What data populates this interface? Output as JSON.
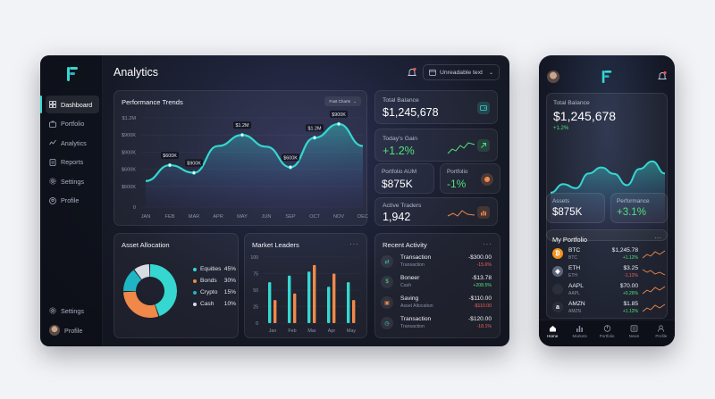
{
  "desktop": {
    "title": "Analytics",
    "date_selector": "Unreadable text",
    "sidebar": {
      "items": [
        {
          "label": "Dashboard",
          "icon": "grid-icon"
        },
        {
          "label": "Portfolio",
          "icon": "briefcase-icon"
        },
        {
          "label": "Analytics",
          "icon": "trend-icon"
        },
        {
          "label": "Reports",
          "icon": "document-icon"
        },
        {
          "label": "Settings",
          "icon": "gear-icon"
        },
        {
          "label": "Profile",
          "icon": "user-icon"
        }
      ],
      "bottom": {
        "settings": "Settings",
        "profile": "Profile"
      }
    },
    "performance": {
      "title": "Performance Trends",
      "filter": "Fast Charts"
    },
    "stats": {
      "total_balance": {
        "label": "Total Balance",
        "value": "$1,245,678"
      },
      "todays_gain": {
        "label": "Today's Gain",
        "value": "+1.2%"
      },
      "aum": {
        "label": "Portfolio AUM",
        "value": "$875K"
      },
      "portfolio": {
        "label": "Portfolio",
        "value": "-1%"
      },
      "traders": {
        "label": "Active Traders",
        "value": "1,942"
      }
    },
    "allocation": {
      "title": "Asset Allocation",
      "items": [
        {
          "name": "Equities",
          "pct": "45%",
          "value": 45,
          "color": "#35d7d0"
        },
        {
          "name": "Bonds",
          "pct": "30%",
          "value": 30,
          "color": "#f0884a"
        },
        {
          "name": "Crypto",
          "pct": "15%",
          "value": 15,
          "color": "#1fb5c4"
        },
        {
          "name": "Cash",
          "pct": "10%",
          "value": 10,
          "color": "#d7dbe4"
        }
      ]
    },
    "market": {
      "title": "Market Leaders"
    },
    "activity": {
      "title": "Recent Activity",
      "rows": [
        {
          "title": "Transaction",
          "sub": "Transaction",
          "amount": "-$300.00",
          "change": "-15.6%",
          "up": false,
          "icon": "swap-icon"
        },
        {
          "title": "Boneer",
          "sub": "Cash",
          "amount": "-$13.78",
          "change": "+208.5%",
          "up": true,
          "icon": "dollar-icon"
        },
        {
          "title": "Saving",
          "sub": "Asset Allocation",
          "amount": "-$110.00",
          "change": "-$110.00",
          "up": false,
          "icon": "wallet-icon"
        },
        {
          "title": "Transaction",
          "sub": "Transaction",
          "amount": "-$120.00",
          "change": "-18.1%",
          "up": false,
          "icon": "clock-icon"
        }
      ]
    }
  },
  "mobile": {
    "balance": {
      "label": "Total Balance",
      "value": "$1,245,678",
      "change": "+1.2%"
    },
    "assets": {
      "label": "Assets",
      "value": "$875K"
    },
    "performance": {
      "label": "Performance",
      "value": "+3.1%"
    },
    "portfolio": {
      "title": "My Portfolio",
      "coins": [
        {
          "name": "BTC",
          "ticker": "BTC",
          "price": "$1,245.78",
          "change": "+1.12%",
          "up": true,
          "color": "#f2931b",
          "glyph": "₿"
        },
        {
          "name": "ETH",
          "ticker": "ETH",
          "price": "$3.25",
          "change": "-1.12%",
          "up": false,
          "color": "#5b6478",
          "glyph": "◆"
        },
        {
          "name": "AAPL",
          "ticker": "AAPL",
          "price": "$70.00",
          "change": "+0.26%",
          "up": true,
          "color": "#2b2f3a",
          "glyph": ""
        },
        {
          "name": "AMZN",
          "ticker": "AMZN",
          "price": "$1.85",
          "change": "+1.12%",
          "up": true,
          "color": "#2b2f3a",
          "glyph": "a"
        }
      ]
    },
    "tabs": [
      {
        "label": "Home",
        "icon": "home-icon"
      },
      {
        "label": "Markets",
        "icon": "bars-icon"
      },
      {
        "label": "Portfolio",
        "icon": "pie-icon"
      },
      {
        "label": "News",
        "icon": "news-icon"
      },
      {
        "label": "Profile",
        "icon": "user-icon"
      }
    ]
  },
  "chart_data": [
    {
      "type": "area",
      "title": "Performance Trends",
      "categories": [
        "JAN",
        "FEB",
        "MAR",
        "APR",
        "MAY",
        "JUN",
        "SEP",
        "OCT",
        "NOV",
        "DEC"
      ],
      "y_ticks": [
        "0",
        "$600K",
        "$600K",
        "$900K",
        "$900K",
        "$1.2M"
      ],
      "y_tick_values": [
        0,
        300,
        550,
        800,
        1050,
        1300
      ],
      "values": [
        380,
        610,
        500,
        890,
        1050,
        880,
        580,
        1010,
        1210,
        890
      ],
      "annotations": [
        {
          "label": "$600K",
          "value": 610
        },
        {
          "label": "$900K",
          "value": 890
        },
        {
          "label": "$1.2M",
          "value": 1210
        },
        {
          "label": "$600K",
          "value": 580
        },
        {
          "label": "$1.2M",
          "value": 1210
        },
        {
          "label": "$900K",
          "value": 890
        }
      ],
      "color": "#35d7d0",
      "ylim": [
        0,
        1300
      ]
    },
    {
      "type": "pie",
      "title": "Asset Allocation",
      "categories": [
        "Equities",
        "Bonds",
        "Crypto",
        "Cash"
      ],
      "values": [
        45,
        30,
        15,
        10
      ]
    },
    {
      "type": "bar",
      "title": "Market Leaders",
      "categories": [
        "Jan",
        "Feb",
        "Mar",
        "Apr",
        "May"
      ],
      "y_ticks": [
        "0",
        "25",
        "50",
        "75",
        "100"
      ],
      "series": [
        {
          "values": [
            62,
            72,
            78,
            55,
            62
          ],
          "color": "#35d7d0"
        },
        {
          "values": [
            35,
            45,
            88,
            75,
            35
          ],
          "color": "#f0884a"
        }
      ],
      "ylim": [
        0,
        100
      ]
    }
  ]
}
